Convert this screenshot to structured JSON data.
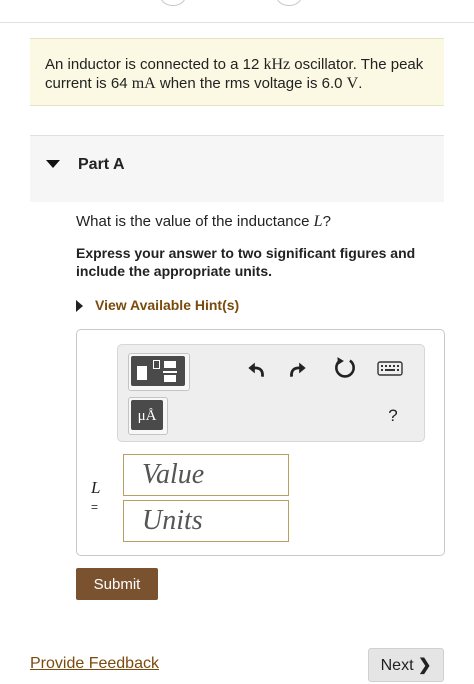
{
  "problem": {
    "text_before_freq": "An inductor is connected to a 12 ",
    "freq_unit": "kHz",
    "text_after_freq": " oscillator. The peak current is 64 ",
    "current_unit": "mA",
    "text_after_current": " when the rms voltage is 6.0 ",
    "voltage_unit": "V",
    "text_end": "."
  },
  "part": {
    "label": "Part A",
    "question_prefix": "What is the value of the inductance ",
    "question_var": "L",
    "question_suffix": "?",
    "instruction": "Express your answer to two significant figures and include the appropriate units.",
    "hint_label": "View Available Hint(s)"
  },
  "toolbar": {
    "templates_icon": "templates-icon",
    "units_label": "μÅ",
    "undo_icon": "undo-icon",
    "redo_icon": "redo-icon",
    "reset_icon": "reset-icon",
    "keyboard_icon": "keyboard-icon",
    "help_label": "?"
  },
  "answer": {
    "variable": "L",
    "equals": "=",
    "value_placeholder": "Value",
    "units_placeholder": "Units"
  },
  "actions": {
    "submit_label": "Submit",
    "feedback_label": "Provide Feedback",
    "next_label": "Next",
    "next_chevron": "❯"
  },
  "colors": {
    "problem_bg": "#fbf8e3",
    "hint_text": "#7a4b0c",
    "submit_bg": "#7a5230",
    "input_border": "#b8a062"
  }
}
